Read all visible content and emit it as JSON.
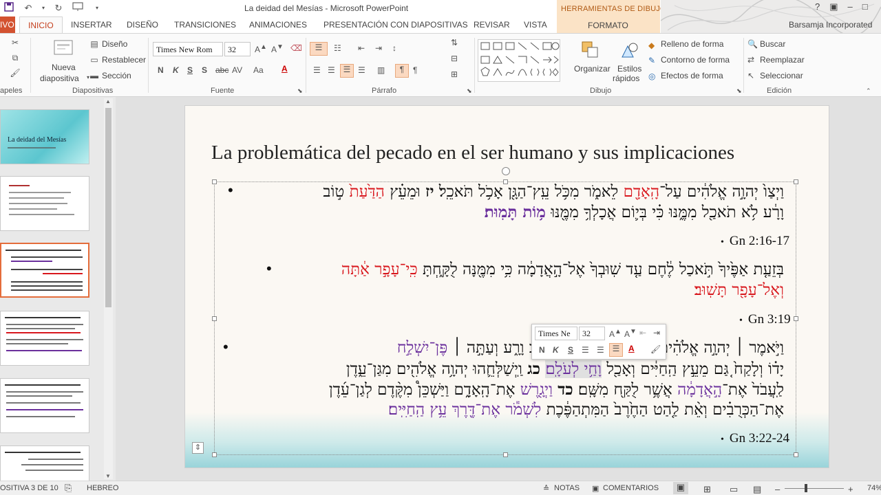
{
  "window": {
    "doc_title": "La deidad del Mesías - Microsoft PowerPoint",
    "context_label": "HERRAMIENTAS DE DIBUJO",
    "user": "Barsamja Incorporated"
  },
  "tabs": {
    "file": "IVO",
    "inicio": "INICIO",
    "insertar": "INSERTAR",
    "diseno": "DISEÑO",
    "transiciones": "TRANSICIONES",
    "animaciones": "ANIMACIONES",
    "presentacion": "PRESENTACIÓN CON DIAPOSITIVAS",
    "revisar": "REVISAR",
    "vista": "VISTA",
    "formato": "FORMATO"
  },
  "ribbon": {
    "portapapeles": "apeles",
    "nueva": "Nueva",
    "diapositiva": "diapositiva",
    "diseno_btn": "Diseño",
    "restablecer": "Restablecer",
    "seccion": "Sección",
    "diapositivas": "Diapositivas",
    "font_name": "Times New Rom",
    "font_size": "32",
    "fuente": "Fuente",
    "parrafo": "Párrafo",
    "organizar": "Organizar",
    "estilos": "Estilos",
    "rapidos": "rápidos",
    "relleno": "Relleno de forma",
    "contorno": "Contorno de forma",
    "efectos": "Efectos de forma",
    "dibujo": "Dibujo",
    "buscar": "Buscar",
    "reemplazar": "Reemplazar",
    "seleccionar": "Seleccionar",
    "edicion": "Edición"
  },
  "thumbnails": {
    "slide1_title": "La deidad del Mesías"
  },
  "slide": {
    "title": "La problemática del pecado en el ser humano y sus implicaciones",
    "v1_line1_a": "וַיְצַו֙ יְהוָ֣ה אֱלֹהִ֔ים עַל־",
    "v1_line1_b": "הָֽאָדָ֖ם",
    "v1_line1_c": " לֵאמֹ֑ר מִכֹּ֥ל עֵֽץ־הַגָּ֖ן אָכֹ֥ל תֹּאכֵֽל׃ ",
    "v1_line1_d": "יז",
    "v1_line1_e": " וּמֵעֵ֗ץ ",
    "v1_line1_f": "הַדַּ֙עַת֙",
    "v1_line1_g": " ט֣וֹב",
    "v1_line2_a": "וָרָ֔ע לֹ֥א תֹאכַ֖ל מִמֶּ֑נּוּ כִּ֗י בְּי֛וֹם אֲכָלְךָ֥ מִמֶּ֖נּוּ ",
    "v1_line2_b": "מ֥וֹת תָּמֽוּת׃",
    "ref1": "Gn 2:16-17",
    "v2_line1_a": "בְּזֵעַ֤ת אַפֶּ֙יךָ֙ תֹּ֣אכַל לֶ֔חֶם עַ֤ד שֽׁוּבְךָ֙ אֶל־הָ֣אֲדָמָ֔ה כִּ֥י מִמֶּ֖נָּה לֻקָּ֑חְתָּ ",
    "v2_line1_b": "כִּֽי־עָפָ֣ר אַ֔תָּה",
    "v2_line2": "וְאֶל־עָפָ֖ר תָּשֽׁוּב׃",
    "ref2": "Gn 3:19",
    "v3_line1_a": "וַיֹּ֣אמֶר ׀ יְהוָ֣ה אֱלֹהִ֗ים ",
    "v3_line1_b": "אַחַ֣ד מִמֶּ֔נּוּ לָדַ֖עַת ט֣וֹב וָרָ֑ע וְעַתָּ֣ה ׀ ",
    "v3_line1_c": "פֶּן־יִשְׁלַ֣ח",
    "v3_line2_a": "יָד֗וֹ וְלָקַח֙ גַּ֚ם מֵעֵ֣ץ הַֽחַיִּ֔ים וְאָכַ֖ל ",
    "v3_line2_b": "וָחַ֥י לְעֹלָֽם׃",
    "v3_line2_c": " ",
    "v3_line2_d": "כג",
    "v3_line2_e": " וַֽיְשַׁלְּחֵ֛הוּ יְהוָ֥ה אֱלֹהִ֖ים מִגַּן־עֵ֑דֶן",
    "v3_line3_a": "לַֽעֲבֹד֙ אֶת־",
    "v3_line3_b": "הָ֣אֲדָמָ֔ה",
    "v3_line3_c": " אֲשֶׁ֥ר לֻקַּ֖ח מִשָּֽׁם׃ ",
    "v3_line3_d": "כד",
    "v3_line3_e": " וַיְגָ֖רֶשׁ",
    "v3_line3_f": " אֶת־הָֽאָדָ֑ם וַיַּשְׁכֵּן֩ מִקֶּ֨דֶם לְגַן־עֵ֜דֶן",
    "v3_line4_a": "אֶת־הַכְּרֻבִ֗ים וְאֵ֨ת לַ֤הַט הַחֶ֙רֶב֙ הַמִּתְהַפֶּ֔כֶת ",
    "v3_line4_b": "לִשְׁמֹ֕ר אֶת־דֶּ֖רֶךְ עֵ֥ץ הַֽחַיִּֽים׃",
    "ref3": "Gn 3:22-24"
  },
  "minitoolbar": {
    "font_name": "Times Ne",
    "font_size": "32"
  },
  "status": {
    "slide_counter": "OSITIVA 3 DE 10",
    "language": "HEBREO",
    "notas": "NOTAS",
    "comentarios": "COMENTARIOS",
    "zoom": "74%"
  },
  "colors": {
    "accent": "#d35230",
    "purple": "#6a2f9c",
    "red": "#d8161c"
  }
}
